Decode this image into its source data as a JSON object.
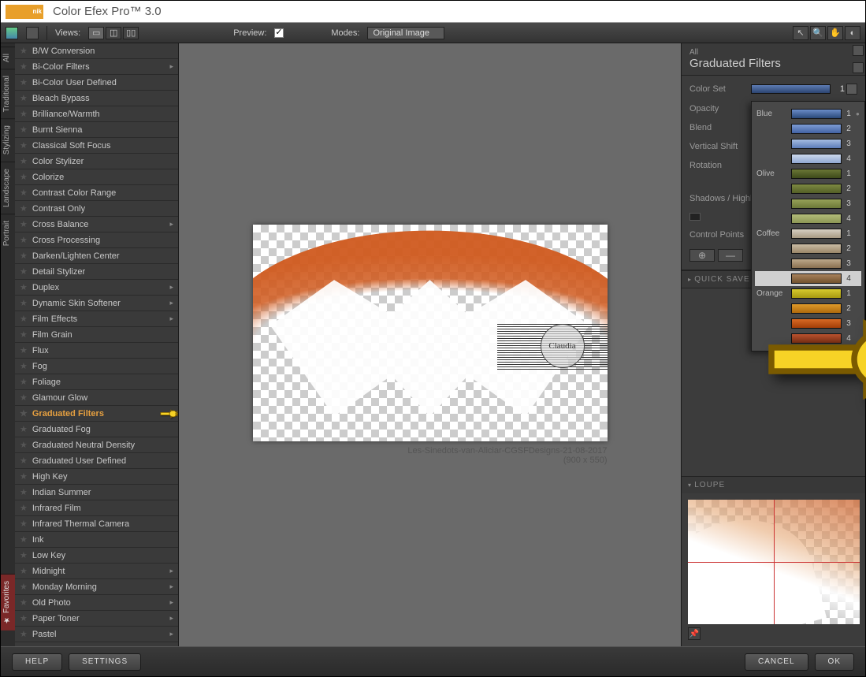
{
  "app": {
    "logo_text": "nik",
    "title": "Color Efex Pro™ 3.0"
  },
  "topbar": {
    "views_label": "Views:",
    "preview_label": "Preview:",
    "modes_label": "Modes:",
    "mode_value": "Original Image"
  },
  "side_tabs": [
    "All",
    "Traditional",
    "Stylizing",
    "Landscape",
    "Portrait"
  ],
  "fav_tab": "Favorites",
  "filters": [
    {
      "name": "B/W Conversion"
    },
    {
      "name": "Bi-Color Filters",
      "chev": true
    },
    {
      "name": "Bi-Color User Defined"
    },
    {
      "name": "Bleach Bypass"
    },
    {
      "name": "Brilliance/Warmth"
    },
    {
      "name": "Burnt Sienna"
    },
    {
      "name": "Classical Soft Focus"
    },
    {
      "name": "Color Stylizer"
    },
    {
      "name": "Colorize"
    },
    {
      "name": "Contrast Color Range"
    },
    {
      "name": "Contrast Only"
    },
    {
      "name": "Cross Balance",
      "chev": true
    },
    {
      "name": "Cross Processing"
    },
    {
      "name": "Darken/Lighten Center"
    },
    {
      "name": "Detail Stylizer"
    },
    {
      "name": "Duplex",
      "chev": true
    },
    {
      "name": "Dynamic Skin Softener",
      "chev": true
    },
    {
      "name": "Film Effects",
      "chev": true
    },
    {
      "name": "Film Grain"
    },
    {
      "name": "Flux"
    },
    {
      "name": "Fog"
    },
    {
      "name": "Foliage"
    },
    {
      "name": "Glamour Glow"
    },
    {
      "name": "Graduated Filters",
      "selected": true,
      "chev": true,
      "pointer": true
    },
    {
      "name": "Graduated Fog"
    },
    {
      "name": "Graduated Neutral Density"
    },
    {
      "name": "Graduated User Defined"
    },
    {
      "name": "High Key"
    },
    {
      "name": "Indian Summer"
    },
    {
      "name": "Infrared Film"
    },
    {
      "name": "Infrared Thermal Camera"
    },
    {
      "name": "Ink"
    },
    {
      "name": "Low Key"
    },
    {
      "name": "Midnight",
      "chev": true
    },
    {
      "name": "Monday Morning",
      "chev": true
    },
    {
      "name": "Old Photo",
      "chev": true
    },
    {
      "name": "Paper Toner",
      "chev": true
    },
    {
      "name": "Pastel",
      "chev": true
    }
  ],
  "canvas": {
    "caption": "Les-Sinedots-van-Aliciar-CGSFDesigns-21-08-2017",
    "dims": "(900 x 550)",
    "watermark": "Claudia"
  },
  "right": {
    "header_small": "All",
    "header_main": "Graduated Filters",
    "controls": {
      "color_set": "Color Set",
      "color_set_val": "1",
      "opacity": "Opacity",
      "blend": "Blend",
      "vshift": "Vertical Shift",
      "rotation": "Rotation",
      "shadows": "Shadows / Highlights",
      "cpoints": "Control Points"
    },
    "quick_save": "QUICK SAVE",
    "loupe": "LOUPE"
  },
  "colorset": {
    "groups": [
      {
        "name": "Blue",
        "swatches": [
          {
            "n": "1",
            "g": "linear-gradient(#6a8cc8,#2a4878)",
            "dot": true
          },
          {
            "n": "2",
            "g": "linear-gradient(#7d9cd4,#4262a3)"
          },
          {
            "n": "3",
            "g": "linear-gradient(#a5bde0,#5c7cb8)"
          },
          {
            "n": "4",
            "g": "linear-gradient(#cdd9ec,#90a8d2)"
          }
        ]
      },
      {
        "name": "Olive",
        "swatches": [
          {
            "n": "1",
            "g": "linear-gradient(#6a7636,#3e4a1a)"
          },
          {
            "n": "2",
            "g": "linear-gradient(#7e8a42,#535f26)"
          },
          {
            "n": "3",
            "g": "linear-gradient(#97a258,#6c7838)"
          },
          {
            "n": "4",
            "g": "linear-gradient(#b3bc7a,#8c9654)"
          }
        ]
      },
      {
        "name": "Coffee",
        "swatches": [
          {
            "n": "1",
            "g": "linear-gradient(#d6cfc2,#a89a82)"
          },
          {
            "n": "2",
            "g": "linear-gradient(#cabca4,#9a8668)"
          },
          {
            "n": "3",
            "g": "linear-gradient(#bca88a,#8a7050)"
          },
          {
            "n": "4",
            "g": "linear-gradient(#a8825c,#72522e)",
            "sel": true
          }
        ]
      },
      {
        "name": "Orange",
        "swatches": [
          {
            "n": "1",
            "g": "linear-gradient(#d6ca2e,#a89a10)"
          },
          {
            "n": "2",
            "g": "linear-gradient(#de9a2a,#b06a0c)"
          },
          {
            "n": "3",
            "g": "linear-gradient(#d86a24,#a43e08)"
          },
          {
            "n": "4",
            "g": "linear-gradient(#b8522e,#7a2e14)"
          }
        ]
      }
    ]
  },
  "bottom": {
    "help": "HELP",
    "settings": "SETTINGS",
    "cancel": "CANCEL",
    "ok": "OK"
  }
}
